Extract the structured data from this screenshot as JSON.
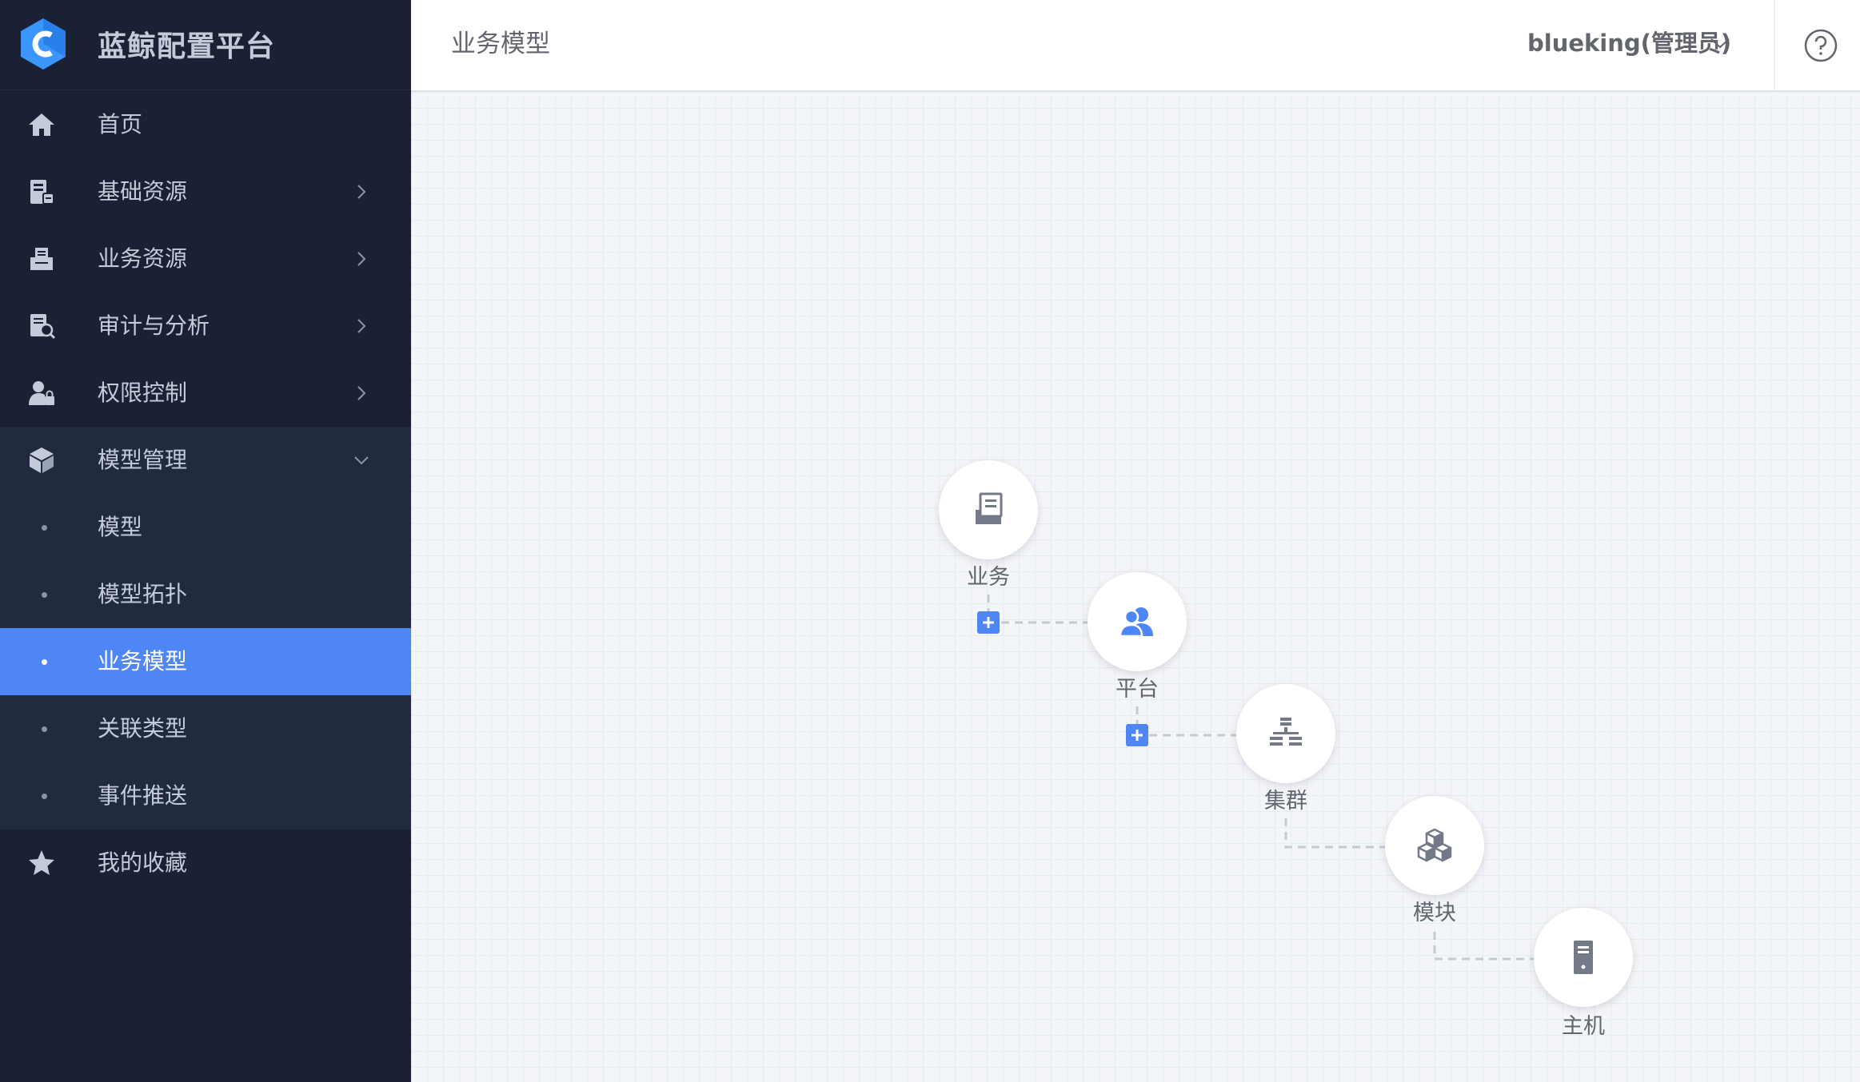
{
  "app": {
    "name": "蓝鲸配置平台",
    "logo_icon": "cmdb-logo-icon"
  },
  "sidebar": {
    "items": [
      {
        "label": "首页",
        "icon": "home-icon"
      },
      {
        "label": "基础资源",
        "icon": "resource-icon"
      },
      {
        "label": "业务资源",
        "icon": "business-resource-icon"
      },
      {
        "label": "审计与分析",
        "icon": "audit-icon"
      },
      {
        "label": "权限控制",
        "icon": "permission-icon"
      },
      {
        "label": "模型管理",
        "icon": "model-cube-icon",
        "expanded": true,
        "children": [
          {
            "label": "模型"
          },
          {
            "label": "模型拓扑"
          },
          {
            "label": "业务模型",
            "active": true
          },
          {
            "label": "关联类型"
          },
          {
            "label": "事件推送"
          }
        ]
      },
      {
        "label": "我的收藏",
        "icon": "star-icon"
      }
    ]
  },
  "header": {
    "title": "业务模型",
    "user": "blueking(管理员)",
    "help_icon": "help-icon"
  },
  "topology": {
    "nodes": [
      {
        "label": "业务",
        "icon": "business-icon"
      },
      {
        "label": "平台",
        "icon": "platform-users-icon"
      },
      {
        "label": "集群",
        "icon": "cluster-icon"
      },
      {
        "label": "模块",
        "icon": "module-icon"
      },
      {
        "label": "主机",
        "icon": "host-icon"
      }
    ]
  },
  "colors": {
    "sidebar_bg": "#1a2134",
    "submenu_bg": "#212a3f",
    "accent": "#4f86f6",
    "text": "#63656e",
    "node_icon": "#737987"
  }
}
